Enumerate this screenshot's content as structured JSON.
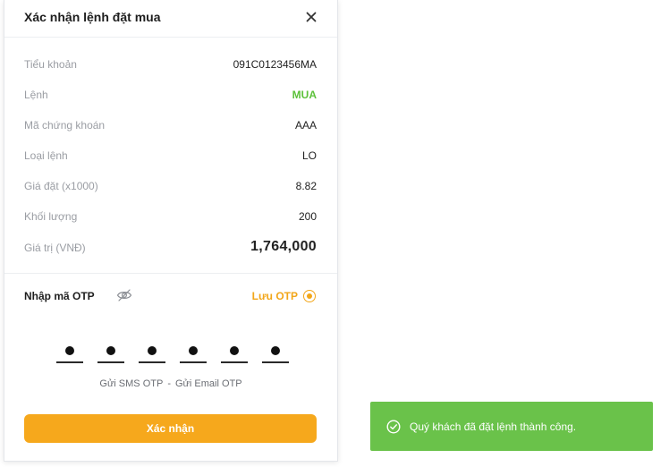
{
  "modal": {
    "title": "Xác nhận lệnh đặt mua",
    "close_icon": "close-icon",
    "rows": [
      {
        "label": "Tiểu khoản",
        "value": "091C0123456MA"
      },
      {
        "label": "Lệnh",
        "value": "MUA"
      },
      {
        "label": "Mã chứng khoán",
        "value": "AAA"
      },
      {
        "label": "Loại lệnh",
        "value": "LO"
      },
      {
        "label": "Giá đặt (x1000)",
        "value": "8.82"
      },
      {
        "label": "Khối lượng",
        "value": "200"
      },
      {
        "label": "Giá trị (VNĐ)",
        "value": "1,764,000"
      }
    ],
    "otp": {
      "label": "Nhập mã OTP",
      "visibility_icon": "eye-off-icon",
      "save_label": "Lưu OTP",
      "save_selected": true,
      "digit_count": 6,
      "send_sms": "Gửi SMS OTP",
      "separator": "-",
      "send_email": "Gửi Email OTP"
    },
    "confirm_label": "Xác nhận"
  },
  "toast": {
    "icon": "check-circle-icon",
    "message": "Quý khách đã đặt lệnh thành công."
  },
  "colors": {
    "accent": "#f6a81c",
    "buy": "#5cc13a",
    "success": "#6ac24a"
  }
}
